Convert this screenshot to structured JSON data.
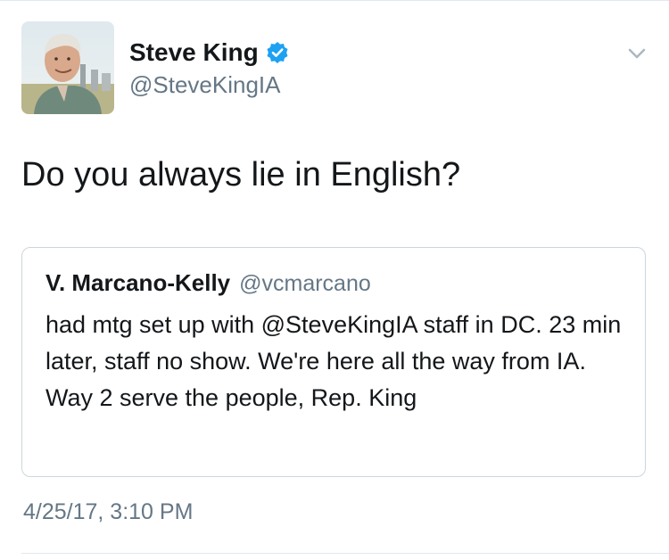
{
  "author": {
    "display_name": "Steve King",
    "handle": "@SteveKingIA",
    "verified": true,
    "avatar_icon": "profile-photo"
  },
  "tweet": {
    "text": "Do you always lie in English?",
    "timestamp": "4/25/17, 3:10 PM"
  },
  "quoted_tweet": {
    "display_name": "V. Marcano-Kelly",
    "handle": "@vcmarcano",
    "text": "had mtg set up with @SteveKingIA staff in DC. 23 min later, staff no show. We're here all the way from IA. Way 2 serve the people, Rep. King"
  },
  "menu_icon": "chevron-down-icon",
  "colors": {
    "verified_badge": "#1da1f2",
    "secondary_text": "#657786",
    "primary_text": "#14171a",
    "border": "#ccd6dd"
  }
}
